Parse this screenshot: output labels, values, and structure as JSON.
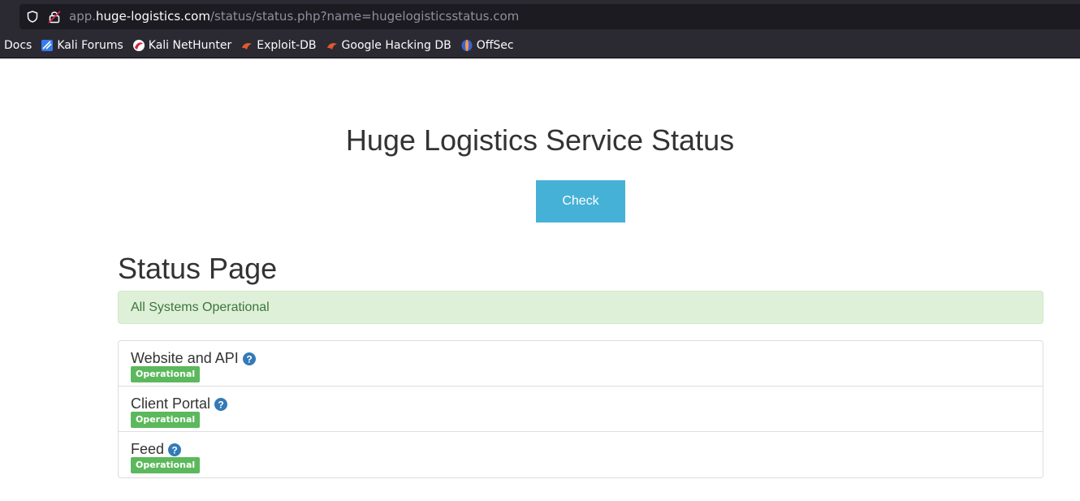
{
  "browser": {
    "url_prefix": "app.",
    "url_host": "huge-logistics.com",
    "url_path": "/status/status.php?name=hugelogisticsstatus.com",
    "bookmarks": [
      {
        "label": "Docs",
        "icon": "none"
      },
      {
        "label": "Kali Forums",
        "icon": "kali-forums-icon"
      },
      {
        "label": "Kali NetHunter",
        "icon": "nethunter-icon"
      },
      {
        "label": "Exploit-DB",
        "icon": "exploit-db-icon"
      },
      {
        "label": "Google Hacking DB",
        "icon": "ghdb-icon"
      },
      {
        "label": "OffSec",
        "icon": "offsec-icon"
      }
    ]
  },
  "page": {
    "title": "Huge Logistics Service Status",
    "check_label": "Check",
    "section_title": "Status Page",
    "alert_text": "All Systems Operational",
    "services": [
      {
        "name": "Website and API",
        "status": "Operational"
      },
      {
        "name": "Client Portal",
        "status": "Operational"
      },
      {
        "name": "Feed",
        "status": "Operational"
      }
    ]
  },
  "colors": {
    "check_button": "#46b1d6",
    "alert_bg": "#dff0d8",
    "alert_text": "#3c763d",
    "badge": "#5cb85c",
    "help_icon": "#337ab7"
  }
}
